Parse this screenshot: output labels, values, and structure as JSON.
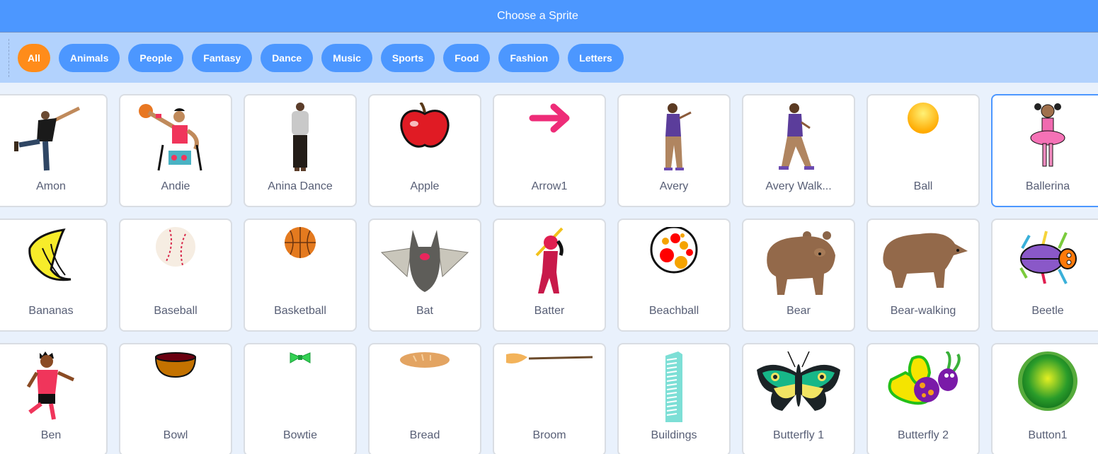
{
  "header": {
    "title": "Choose a Sprite"
  },
  "filters": [
    {
      "label": "All",
      "active": true
    },
    {
      "label": "Animals",
      "active": false
    },
    {
      "label": "People",
      "active": false
    },
    {
      "label": "Fantasy",
      "active": false
    },
    {
      "label": "Dance",
      "active": false
    },
    {
      "label": "Music",
      "active": false
    },
    {
      "label": "Sports",
      "active": false
    },
    {
      "label": "Food",
      "active": false
    },
    {
      "label": "Fashion",
      "active": false
    },
    {
      "label": "Letters",
      "active": false
    }
  ],
  "colors": {
    "header": "#4c97ff",
    "filterbar": "#b2d2fd",
    "active_filter": "#ff8c1a",
    "filter": "#4c97ff",
    "hover_border": "#4c97ff"
  },
  "sprites": [
    {
      "name": "Amon",
      "icon": "dancer-person-icon"
    },
    {
      "name": "Andie",
      "icon": "wheelchair-basketball-player-icon"
    },
    {
      "name": "Anina Dance",
      "icon": "standing-person-icon"
    },
    {
      "name": "Apple",
      "icon": "apple-icon"
    },
    {
      "name": "Arrow1",
      "icon": "arrow-right-icon"
    },
    {
      "name": "Avery",
      "icon": "girl-standing-icon"
    },
    {
      "name": "Avery Walk...",
      "icon": "girl-walking-icon"
    },
    {
      "name": "Ball",
      "icon": "ball-icon"
    },
    {
      "name": "Ballerina",
      "icon": "ballerina-icon",
      "hover": true
    },
    {
      "name": "Bananas",
      "icon": "bananas-icon"
    },
    {
      "name": "Baseball",
      "icon": "baseball-icon"
    },
    {
      "name": "Basketball",
      "icon": "basketball-icon"
    },
    {
      "name": "Bat",
      "icon": "bat-icon"
    },
    {
      "name": "Batter",
      "icon": "batter-icon"
    },
    {
      "name": "Beachball",
      "icon": "beachball-icon"
    },
    {
      "name": "Bear",
      "icon": "bear-icon"
    },
    {
      "name": "Bear-walking",
      "icon": "bear-walking-icon"
    },
    {
      "name": "Beetle",
      "icon": "beetle-icon"
    },
    {
      "name": "Ben",
      "icon": "boy-running-icon"
    },
    {
      "name": "Bowl",
      "icon": "bowl-icon"
    },
    {
      "name": "Bowtie",
      "icon": "bowtie-icon"
    },
    {
      "name": "Bread",
      "icon": "bread-icon"
    },
    {
      "name": "Broom",
      "icon": "broom-icon"
    },
    {
      "name": "Buildings",
      "icon": "building-icon"
    },
    {
      "name": "Butterfly 1",
      "icon": "butterfly-icon"
    },
    {
      "name": "Butterfly 2",
      "icon": "butterfly-bug-icon"
    },
    {
      "name": "Button1",
      "icon": "green-button-icon"
    }
  ]
}
